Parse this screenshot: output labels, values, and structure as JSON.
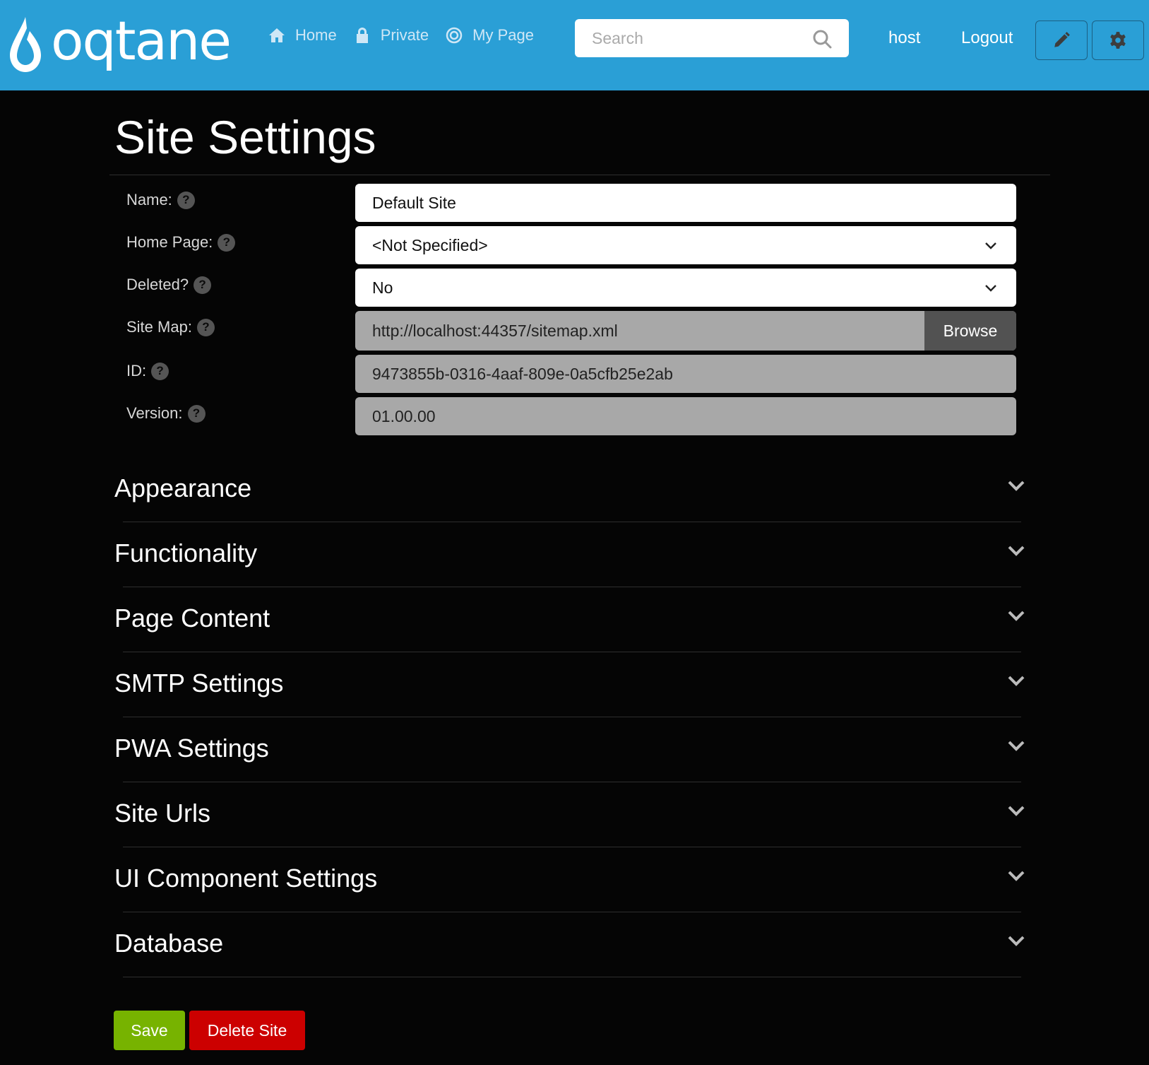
{
  "header": {
    "logo_text": "oqtane",
    "nav": [
      {
        "label": "Home",
        "icon": "home-icon"
      },
      {
        "label": "Private",
        "icon": "lock-icon"
      },
      {
        "label": "My Page",
        "icon": "target-icon"
      }
    ],
    "search_placeholder": "Search",
    "user": "host",
    "logout": "Logout"
  },
  "page": {
    "title": "Site Settings"
  },
  "form": {
    "name": {
      "label": "Name:",
      "value": "Default Site"
    },
    "home_page": {
      "label": "Home Page:",
      "value": "<Not Specified>"
    },
    "deleted": {
      "label": "Deleted?",
      "value": "No"
    },
    "site_map": {
      "label": "Site Map:",
      "value": "http://localhost:44357/sitemap.xml",
      "button": "Browse"
    },
    "id": {
      "label": "ID:",
      "value": "9473855b-0316-4aaf-809e-0a5cfb25e2ab"
    },
    "version": {
      "label": "Version:",
      "value": "01.00.00"
    },
    "help_glyph": "?"
  },
  "sections": [
    "Appearance",
    "Functionality",
    "Page Content",
    "SMTP Settings",
    "PWA Settings",
    "Site Urls",
    "UI Component Settings",
    "Database"
  ],
  "actions": {
    "save": "Save",
    "delete": "Delete Site"
  },
  "colors": {
    "header_bg": "#2a9fd6",
    "save": "#77b300",
    "delete": "#cc0000"
  }
}
